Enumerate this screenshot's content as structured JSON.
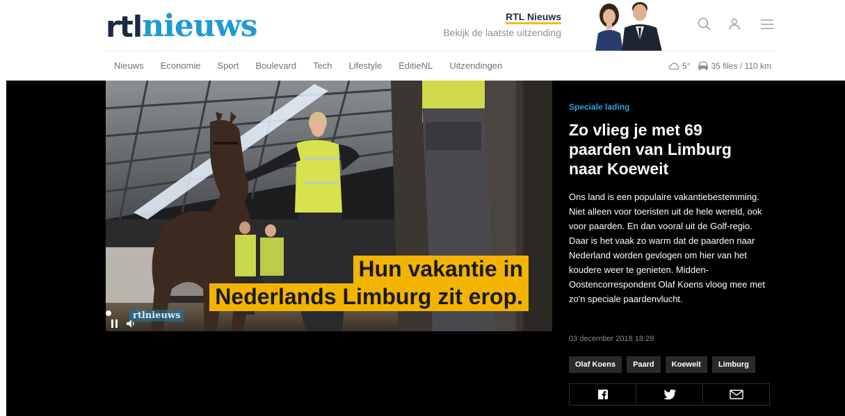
{
  "logo": {
    "part1": "rtl",
    "part2": "nieuws"
  },
  "latest": {
    "title": "RTL Nieuws",
    "subtitle": "Bekijk de laatste uitzending"
  },
  "header_icons": [
    "search-icon",
    "user-icon",
    "menu-icon"
  ],
  "nav": [
    "Nieuws",
    "Economie",
    "Sport",
    "Boulevard",
    "Tech",
    "Lifestyle",
    "EditieNL",
    "Uitzendingen"
  ],
  "status": {
    "temperature": "5°",
    "traffic": "35 files / 110 km"
  },
  "video": {
    "subtitle_line1": "Hun vakantie in",
    "subtitle_line2": "Nederlands Limburg zit erop.",
    "watermark": "rtlnieuws"
  },
  "article": {
    "kicker": "Speciale lading",
    "headline": "Zo vlieg je met 69 paarden van Limburg naar Koeweit",
    "lead": "Ons land is een populaire vakantiebestemming. Niet alleen voor toeristen uit de hele wereld, ook voor paarden. En dan vooral uit de Golf-regio. Daar is het vaak zo warm dat de paarden naar Nederland worden gevlogen om hier van het koudere weer te genieten. Midden-Oostencorrespondent Olaf Koens vloog mee met zo'n speciale paardenvlucht.",
    "date": "03 december 2018 18:28",
    "tags": [
      "Olaf Koens",
      "Paard",
      "Koeweit",
      "Limburg"
    ]
  },
  "share": [
    "facebook-icon",
    "twitter-icon",
    "mail-icon"
  ],
  "colors": {
    "brand_navy": "#1b2b45",
    "brand_blue": "#1f9ad6",
    "accent_yellow": "#f2b400",
    "kicker_blue": "#2da5e0",
    "hero_bg": "#000000"
  }
}
